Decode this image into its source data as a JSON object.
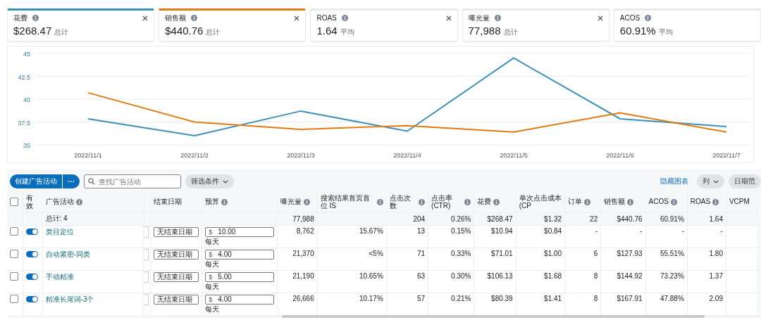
{
  "metric_cards": [
    {
      "label": "花费",
      "value": "$268.47",
      "unit": "总计",
      "selected": true,
      "color": "#3b8fb8",
      "closable": true
    },
    {
      "label": "销售额",
      "value": "$440.76",
      "unit": "总计",
      "selected": true,
      "color": "#e07b12",
      "closable": true
    },
    {
      "label": "ROAS",
      "value": "1.64",
      "unit": "平均",
      "selected": false,
      "closable": true
    },
    {
      "label": "曝光量",
      "value": "77,988",
      "unit": "总计",
      "selected": false,
      "closable": true
    },
    {
      "label": "ACOS",
      "value": "60.91%",
      "unit": "平均",
      "selected": false,
      "closable": false
    }
  ],
  "chart": {
    "chart_data": {
      "type": "line",
      "grid": true,
      "categories": [
        "2022/11/1",
        "2022/11/2",
        "2022/11/3",
        "2022/11/4",
        "2022/11/5",
        "2022/11/6",
        "2022/11/7"
      ],
      "ylim": [
        35,
        45
      ],
      "yticks": [
        35,
        37.5,
        40,
        42.5,
        45
      ],
      "series": [
        {
          "color": "#3b8fb8",
          "values": [
            37.85,
            36.0,
            38.7,
            36.5,
            44.5,
            37.85,
            37.0
          ]
        },
        {
          "color": "#e07b12",
          "values": [
            40.7,
            37.5,
            36.7,
            37.1,
            36.4,
            38.5,
            36.4
          ]
        }
      ]
    }
  },
  "toolbar": {
    "create_button": "创建广告活动",
    "more_button": "···",
    "search": {
      "placeholder": "查找广告活动"
    },
    "filter_button": "筛选条件",
    "hide_chart_link": "隐藏图表",
    "columns_button": "列",
    "date_range_button": "日期范"
  },
  "table": {
    "select_all": {
      "checked": false
    },
    "columns": [
      {
        "label": "有效",
        "info": false
      },
      {
        "label": "广告活动",
        "info": true
      },
      {
        "label": "结束日期",
        "info": false
      },
      {
        "label": "预算",
        "info": true
      }
    ],
    "metric_columns": [
      {
        "label": "曝光量",
        "info": true
      },
      {
        "label": "搜索结果首页首位 IS",
        "info": true
      },
      {
        "label": "点击次数",
        "info": true
      },
      {
        "label": "点击率 (CTR)",
        "info": true
      },
      {
        "label": "花费",
        "info": true
      },
      {
        "label": "单次点击成本 (CP",
        "info": false
      },
      {
        "label": "订单",
        "info": true
      },
      {
        "label": "销售额",
        "info": true
      },
      {
        "label": "ACOS",
        "info": true
      },
      {
        "label": "ROAS",
        "info": true
      },
      {
        "label": "VCPM",
        "info": false
      }
    ],
    "total": {
      "label": "总计: 4",
      "impressions": "77,988",
      "metrics": [
        "204",
        "0.26%",
        "$268.47",
        "$1.32",
        "22",
        "$440.76",
        "60.91%",
        "1.64"
      ]
    },
    "rows": [
      {
        "checked": false,
        "on": true,
        "campaign": "类目定位",
        "end_date": "无结束日期",
        "budget": {
          "currency": "$",
          "amount": "10.00",
          "period": "每天"
        },
        "metrics": [
          "8,762",
          "15.67%",
          "13",
          "0.15%",
          "$10.94",
          "$0.84",
          "-",
          "-",
          "-",
          "-"
        ]
      },
      {
        "checked": false,
        "on": true,
        "campaign": "自动紧密-同类",
        "end_date": "无结束日期",
        "budget": {
          "currency": "$",
          "amount": "4.00",
          "period": "每天"
        },
        "metrics": [
          "21,370",
          "<5%",
          "71",
          "0.33%",
          "$71.01",
          "$1.00",
          "6",
          "$127.93",
          "55.51%",
          "1.80"
        ]
      },
      {
        "checked": false,
        "on": true,
        "campaign": "手动精准",
        "end_date": "无结束日期",
        "budget": {
          "currency": "$",
          "amount": "5.00",
          "period": "每天"
        },
        "metrics": [
          "21,190",
          "10.65%",
          "63",
          "0.30%",
          "$106.13",
          "$1.68",
          "8",
          "$144.92",
          "73.23%",
          "1.37"
        ]
      },
      {
        "checked": false,
        "on": true,
        "campaign": "精准长尾词-3个",
        "end_date": "无结束日期",
        "budget": {
          "currency": "$",
          "amount": "4.00",
          "period": "每天"
        },
        "metrics": [
          "26,666",
          "10.17%",
          "57",
          "0.21%",
          "$80.39",
          "$1.41",
          "8",
          "$167.91",
          "47.88%",
          "2.09"
        ]
      }
    ]
  }
}
